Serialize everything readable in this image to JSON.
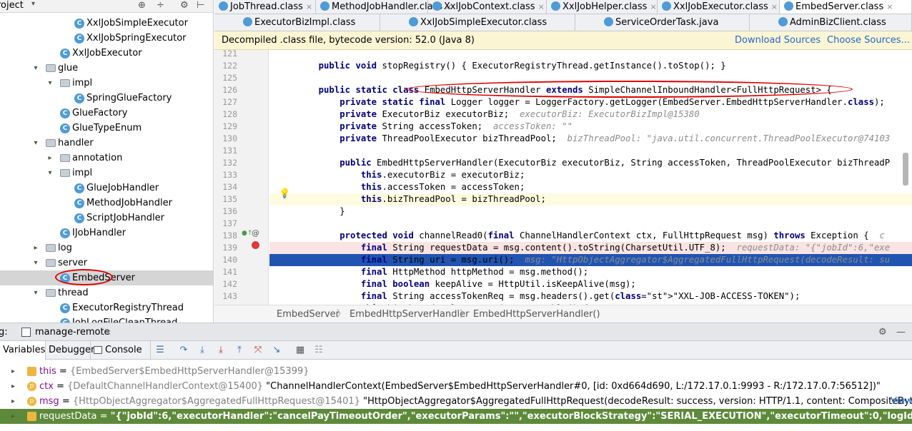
{
  "project": {
    "title": "roject",
    "tree": [
      {
        "label": "XxlJobSimpleExecutor",
        "indent": 104,
        "icon": "class",
        "arrow": ""
      },
      {
        "label": "XxlJobSpringExecutor",
        "indent": 104,
        "icon": "class",
        "arrow": ""
      },
      {
        "label": "XxlJobExecutor",
        "indent": 84,
        "icon": "class",
        "arrow": ""
      },
      {
        "label": "glue",
        "indent": 64,
        "icon": "folder",
        "arrow": "v"
      },
      {
        "label": "impl",
        "indent": 84,
        "icon": "folder",
        "arrow": "v"
      },
      {
        "label": "SpringGlueFactory",
        "indent": 104,
        "icon": "class",
        "arrow": ""
      },
      {
        "label": "GlueFactory",
        "indent": 84,
        "icon": "class",
        "arrow": ""
      },
      {
        "label": "GlueTypeEnum",
        "indent": 84,
        "icon": "class",
        "arrow": ""
      },
      {
        "label": "handler",
        "indent": 64,
        "icon": "folder",
        "arrow": "v"
      },
      {
        "label": "annotation",
        "indent": 84,
        "icon": "folder",
        "arrow": ">"
      },
      {
        "label": "impl",
        "indent": 84,
        "icon": "folder",
        "arrow": "v"
      },
      {
        "label": "GlueJobHandler",
        "indent": 104,
        "icon": "class",
        "arrow": ""
      },
      {
        "label": "MethodJobHandler",
        "indent": 104,
        "icon": "class",
        "arrow": ""
      },
      {
        "label": "ScriptJobHandler",
        "indent": 104,
        "icon": "class",
        "arrow": ""
      },
      {
        "label": "IJobHandler",
        "indent": 84,
        "icon": "class",
        "arrow": ""
      },
      {
        "label": "log",
        "indent": 64,
        "icon": "folder",
        "arrow": ">"
      },
      {
        "label": "server",
        "indent": 64,
        "icon": "folder",
        "arrow": "v"
      },
      {
        "label": "EmbedServer",
        "indent": 84,
        "icon": "class",
        "arrow": "",
        "selected": true
      },
      {
        "label": "thread",
        "indent": 64,
        "icon": "folder",
        "arrow": "v"
      },
      {
        "label": "ExecutorRegistryThread",
        "indent": 84,
        "icon": "class",
        "arrow": ""
      },
      {
        "label": "JobLogFileCleanThread",
        "indent": 84,
        "icon": "class",
        "arrow": ""
      }
    ]
  },
  "tabs_row1": [
    {
      "label": "JobThread.class",
      "active": false
    },
    {
      "label": "MethodJobHandler.class",
      "active": false
    },
    {
      "label": "XxlJobContext.class",
      "active": false
    },
    {
      "label": "XxlJobHelper.class",
      "active": false
    },
    {
      "label": "XxlJobExecutor.class",
      "active": false
    },
    {
      "label": "EmbedServer.class",
      "active": true
    }
  ],
  "tabs_row2": [
    {
      "label": "ExecutorBizImpl.class"
    },
    {
      "label": "XxlJobSimpleExecutor.class"
    },
    {
      "label": "ServiceOrderTask.java"
    },
    {
      "label": "AdminBizClient.class"
    }
  ],
  "banner": {
    "message": "Decompiled .class file, bytecode version: 52.0 (Java 8)",
    "download": "Download Sources",
    "choose": "Choose Sources..."
  },
  "code_lines": [
    {
      "n": "121",
      "t": ""
    },
    {
      "n": "122",
      "t": "    public void stopRegistry() { ExecutorRegistryThread.getInstance().toStop(); }"
    },
    {
      "n": "125",
      "t": ""
    },
    {
      "n": "126",
      "t": "    public static class EmbedHttpServerHandler extends SimpleChannelInboundHandler<FullHttpRequest> {"
    },
    {
      "n": "127",
      "t": "        private static final Logger logger = LoggerFactory.getLogger(EmbedServer.EmbedHttpServerHandler.class);"
    },
    {
      "n": "128",
      "t": "        private ExecutorBiz executorBiz;  executorBiz: ExecutorBizImpl@15380"
    },
    {
      "n": "129",
      "t": "        private String accessToken;  accessToken: \"\""
    },
    {
      "n": "130",
      "t": "        private ThreadPoolExecutor bizThreadPool;  bizThreadPool: \"java.util.concurrent.ThreadPoolExecutor@74103"
    },
    {
      "n": "131",
      "t": ""
    },
    {
      "n": "132",
      "t": "        public EmbedHttpServerHandler(ExecutorBiz executorBiz, String accessToken, ThreadPoolExecutor bizThreadP"
    },
    {
      "n": "133",
      "t": "            this.executorBiz = executorBiz;"
    },
    {
      "n": "134",
      "t": "            this.accessToken = accessToken;"
    },
    {
      "n": "135",
      "t": "            this.bizThreadPool = bizThreadPool;"
    },
    {
      "n": "136",
      "t": "        }"
    },
    {
      "n": "137",
      "t": ""
    },
    {
      "n": "138",
      "t": "        protected void channelRead0(final ChannelHandlerContext ctx, FullHttpRequest msg) throws Exception {  c"
    },
    {
      "n": "139",
      "t": "            final String requestData = msg.content().toString(CharsetUtil.UTF_8);  requestData: \"{\"jobId\":6,\"exe"
    },
    {
      "n": "140",
      "t": "            final String uri = msg.uri();  msg: \"HttpObjectAggregator$AggregatedFullHttpRequest(decodeResult: su"
    },
    {
      "n": "141",
      "t": "            final HttpMethod httpMethod = msg.method();"
    },
    {
      "n": "142",
      "t": "            final boolean keepAlive = HttpUtil.isKeepAlive(msg);"
    },
    {
      "n": "143",
      "t": "            final String accessTokenReq = msg.headers().get(\"XXL-JOB-ACCESS-TOKEN\");"
    },
    {
      "n": "144",
      "t": "            this.bizThreadPool.execute(new Runnable() {"
    }
  ],
  "breadcrumbs": [
    "EmbedServer",
    "EmbedHttpServerHandler",
    "EmbedHttpServerHandler()"
  ],
  "debug": {
    "label": "g:",
    "config": "manage-remote",
    "tabs": [
      "Variables",
      "Debugger",
      "Console"
    ],
    "variables": [
      {
        "name": "this",
        "type": "{EmbedServer$EmbedHttpServerHandler@15399}",
        "value": "",
        "icon": "field"
      },
      {
        "name": "ctx",
        "type": "{DefaultChannelHandlerContext@15400}",
        "value": "\"ChannelHandlerContext(EmbedServer$EmbedHttpServerHandler#0, [id: 0xd664d690, L:/172.17.0.1:9993 - R:/172.17.0.7:56512])\"",
        "icon": "p"
      },
      {
        "name": "msg",
        "type": "{HttpObjectAggregator$AggregatedFullHttpRequest@15401}",
        "value": "\"HttpObjectAggregator$AggregatedFullHttpRequest(decodeResult: success, version: HTTP/1.1, content: CompositeByteBuf(ridx: 0, widx...",
        "icon": "p",
        "link": "View"
      },
      {
        "name": "requestData",
        "type": "",
        "value": "\"{\"jobId\":6,\"executorHandler\":\"cancelPayTimeoutOrder\",\"executorParams\":\"\",\"executorBlockStrategy\":\"SERIAL_EXECUTION\",\"executorTimeout\":0,\"logId\":22064,\"logDateTime\":161...",
        "icon": "field",
        "selected": true
      }
    ]
  }
}
